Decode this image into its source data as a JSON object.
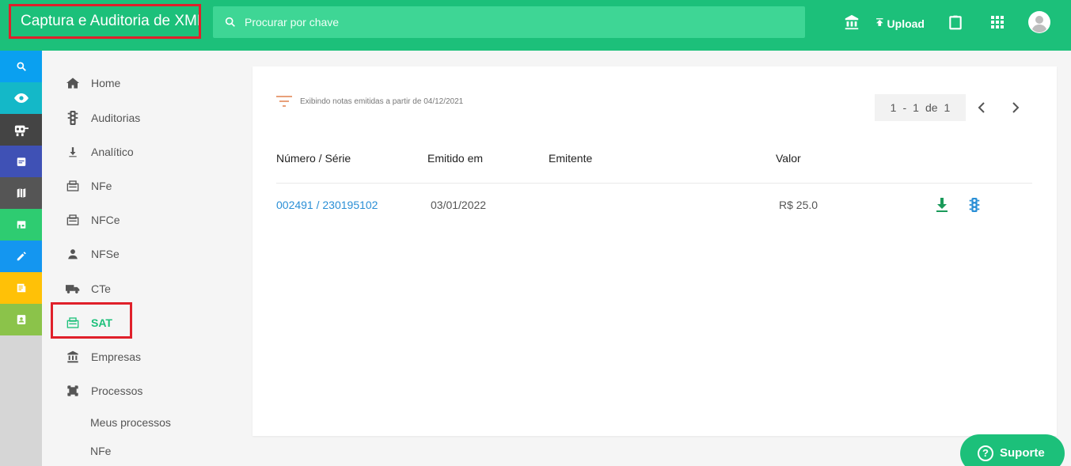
{
  "header": {
    "title": "Captura e Auditoria de XML",
    "search_placeholder": "Procurar por chave",
    "upload_label": "Upload"
  },
  "rail": {
    "items": [
      {
        "icon": "zoom-icon",
        "color": "#0aa0f0"
      },
      {
        "icon": "eye-icon",
        "color": "#14b8c8"
      },
      {
        "icon": "robot-icon",
        "color": "#444444"
      },
      {
        "icon": "calendar-icon",
        "color": "#3f51b5"
      },
      {
        "icon": "map-icon",
        "color": "#555555"
      },
      {
        "icon": "store-icon",
        "color": "#2ecc71"
      },
      {
        "icon": "pencil-icon",
        "color": "#1496f0"
      },
      {
        "icon": "receipt-icon",
        "color": "#ffc107"
      },
      {
        "icon": "contact-icon",
        "color": "#8bc34a"
      }
    ]
  },
  "nav": {
    "items": [
      {
        "label": "Home",
        "icon": "home-icon"
      },
      {
        "label": "Auditorias",
        "icon": "traffic-light-icon"
      },
      {
        "label": "Analítico",
        "icon": "download-icon"
      },
      {
        "label": "NFe",
        "icon": "receipt-box-icon"
      },
      {
        "label": "NFCe",
        "icon": "receipt-box-icon"
      },
      {
        "label": "NFSe",
        "icon": "person-icon"
      },
      {
        "label": "CTe",
        "icon": "truck-icon"
      },
      {
        "label": "SAT",
        "icon": "receipt-box-icon"
      },
      {
        "label": "Empresas",
        "icon": "bank-icon"
      },
      {
        "label": "Processos",
        "icon": "process-icon"
      }
    ],
    "active": "SAT",
    "sub_items": [
      "Meus processos",
      "NFe"
    ]
  },
  "main": {
    "filter_note": "Exibindo notas emitidas a partir de 04/12/2021",
    "pager": {
      "from": "1",
      "sep": "-",
      "to": "1",
      "of_label": "de",
      "total": "1"
    },
    "columns": [
      "Número / Série",
      "Emitido em",
      "Emitente",
      "Valor"
    ],
    "rows": [
      {
        "numero": "002491 / 230195102",
        "emitido": "03/01/2022",
        "emitente": "",
        "valor": "R$ 25.0"
      }
    ]
  },
  "support": {
    "label": "Suporte",
    "icon_text": "?"
  },
  "colors": {
    "brand": "#1cc07a",
    "link": "#2a8fd6",
    "highlight": "#e0202a"
  }
}
